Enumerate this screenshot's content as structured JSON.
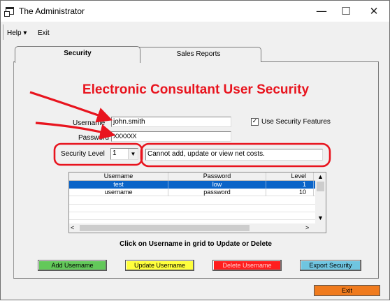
{
  "window": {
    "title": "The Administrator",
    "controls": {
      "minimize": "—",
      "maximize": "☐",
      "close": "✕"
    }
  },
  "menu": {
    "help": "Help ▾",
    "exit": "Exit"
  },
  "tabs": [
    {
      "label": "Security",
      "active": true
    },
    {
      "label": "Sales Reports",
      "active": false
    }
  ],
  "heading": "Electronic Consultant User Security",
  "form": {
    "username_label": "Username",
    "username_value": "john.smith",
    "password_label": "Password",
    "password_value": "XXXXXX",
    "security_level_label": "Security Level",
    "security_level_value": "1",
    "security_level_description": "Cannot add, update or view net costs.",
    "use_security_label": "Use Security Features",
    "use_security_checked": true,
    "check_mark": "✓"
  },
  "grid": {
    "columns": [
      "Username",
      "Password",
      "Level"
    ],
    "rows": [
      {
        "username": "test",
        "password": "low",
        "level": "1",
        "selected": true
      },
      {
        "username": "username",
        "password": "password",
        "level": "10",
        "selected": false
      }
    ],
    "scroll_up": "▲",
    "scroll_down": "▼",
    "scroll_left": "<",
    "scroll_right": ">"
  },
  "hint": "Click on Username in grid to Update or Delete",
  "buttons": {
    "add": "Add Username",
    "update": "Update Username",
    "delete": "Delete Username",
    "export": "Export Security",
    "exit": "Exit"
  },
  "colors": {
    "heading": "#e8141e",
    "annotation": "#e8141e",
    "selection": "#0a64c8",
    "add": "#63c85a",
    "update": "#ffff3c",
    "delete": "#ff1e1e",
    "export": "#6fc5e0",
    "exit": "#f07b1e"
  }
}
